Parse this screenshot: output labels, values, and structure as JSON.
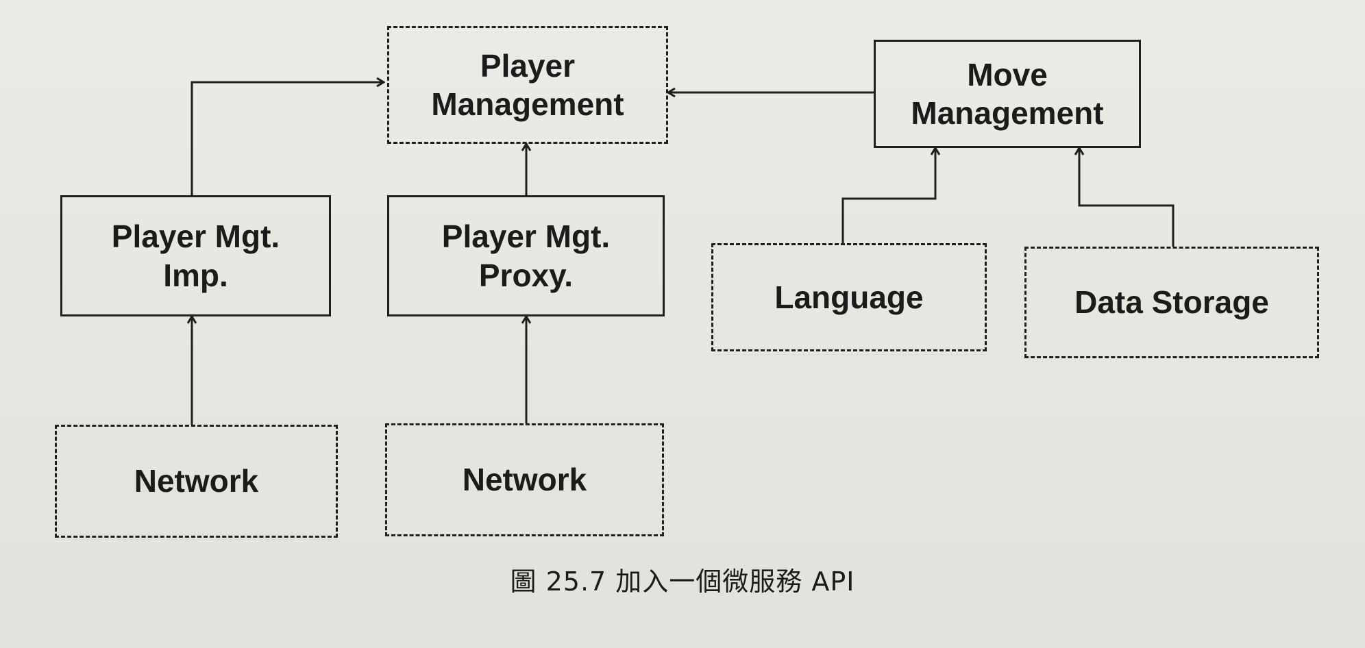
{
  "nodes": {
    "player_management": "Player\nManagement",
    "move_management": "Move\nManagement",
    "player_mgt_imp": "Player Mgt.\nImp.",
    "player_mgt_proxy": "Player Mgt.\nProxy.",
    "language": "Language",
    "data_storage": "Data Storage",
    "network_left": "Network",
    "network_right": "Network"
  },
  "caption": "圖 25.7  加入一個微服務 API",
  "styles": {
    "solid_box": "solid",
    "dashed_box": "dashed",
    "line_color": "#1f1f1f"
  }
}
